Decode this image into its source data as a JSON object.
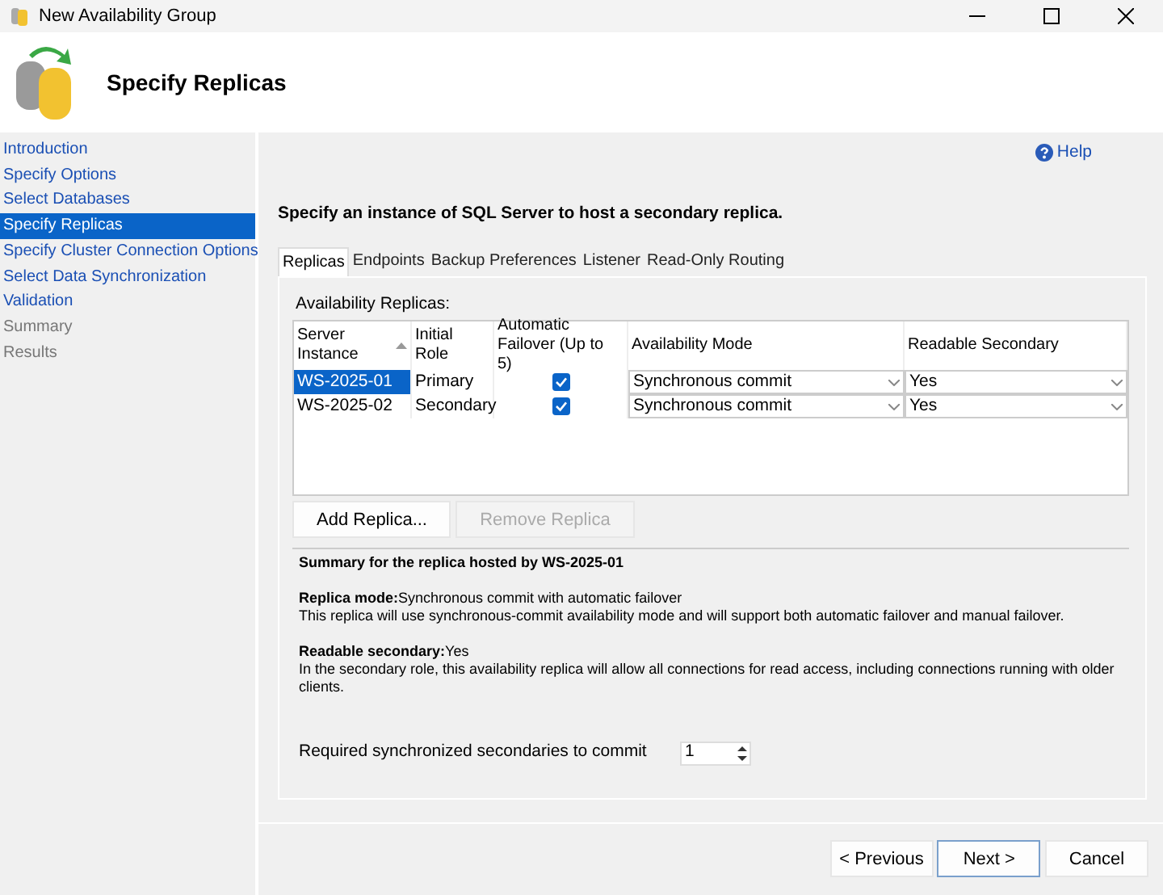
{
  "window": {
    "title": "New Availability Group"
  },
  "header": {
    "title": "Specify Replicas"
  },
  "sidebar": {
    "items": [
      {
        "label": "Introduction",
        "selected": false,
        "disabled": false
      },
      {
        "label": "Specify Options",
        "selected": false,
        "disabled": false
      },
      {
        "label": "Select Databases",
        "selected": false,
        "disabled": false
      },
      {
        "label": "Specify Replicas",
        "selected": true,
        "disabled": false
      },
      {
        "label": "Specify Cluster Connection Options",
        "selected": false,
        "disabled": false
      },
      {
        "label": "Select Data Synchronization",
        "selected": false,
        "disabled": false
      },
      {
        "label": "Validation",
        "selected": false,
        "disabled": false
      },
      {
        "label": "Summary",
        "selected": false,
        "disabled": true
      },
      {
        "label": "Results",
        "selected": false,
        "disabled": true
      }
    ]
  },
  "help": "Help",
  "instruction": "Specify an instance of SQL Server to host a secondary replica.",
  "tabs": [
    {
      "label": "Replicas",
      "selected": true
    },
    {
      "label": "Endpoints",
      "selected": false
    },
    {
      "label": "Backup Preferences",
      "selected": false
    },
    {
      "label": "Listener",
      "selected": false
    },
    {
      "label": "Read-Only Routing",
      "selected": false
    }
  ],
  "replicas": {
    "label": "Availability Replicas:",
    "columns": [
      {
        "label": "Server Instance",
        "sorted": true
      },
      {
        "label": "Initial Role",
        "sorted": false
      },
      {
        "label": "Automatic Failover (Up to 5)",
        "sorted": false
      },
      {
        "label": "Availability Mode",
        "sorted": false
      },
      {
        "label": "Readable Secondary",
        "sorted": false
      }
    ],
    "rows": [
      {
        "server": "WS-2025-01",
        "role": "Primary",
        "automatic_failover": true,
        "mode": "Synchronous commit",
        "readable": "Yes",
        "selected": true
      },
      {
        "server": "WS-2025-02",
        "role": "Secondary",
        "automatic_failover": true,
        "mode": "Synchronous commit",
        "readable": "Yes",
        "selected": false
      }
    ]
  },
  "buttons": [
    {
      "label": "Add Replica...",
      "disabled": false
    },
    {
      "label": "Remove Replica",
      "disabled": true
    }
  ],
  "summary": {
    "title": "Summary for the replica hosted by WS-2025-01",
    "paragraphs": [
      {
        "heading": "**Replica mode:**Synchronous commit with automatic failover",
        "text": "This replica will use synchronous-commit availability mode and will support both automatic failover and manual failover."
      },
      {
        "heading": "**Readable secondary:**Yes",
        "text": "In the secondary role, this availability replica will allow all connections for read access, including connections running with older clients."
      }
    ]
  },
  "required_secondaries": {
    "label": "Required synchronized secondaries to commit",
    "value": "1"
  },
  "footer": [
    {
      "label": "< Previous",
      "default": false
    },
    {
      "label": "Next >",
      "default": true
    },
    {
      "label": "Cancel",
      "default": false
    }
  ]
}
